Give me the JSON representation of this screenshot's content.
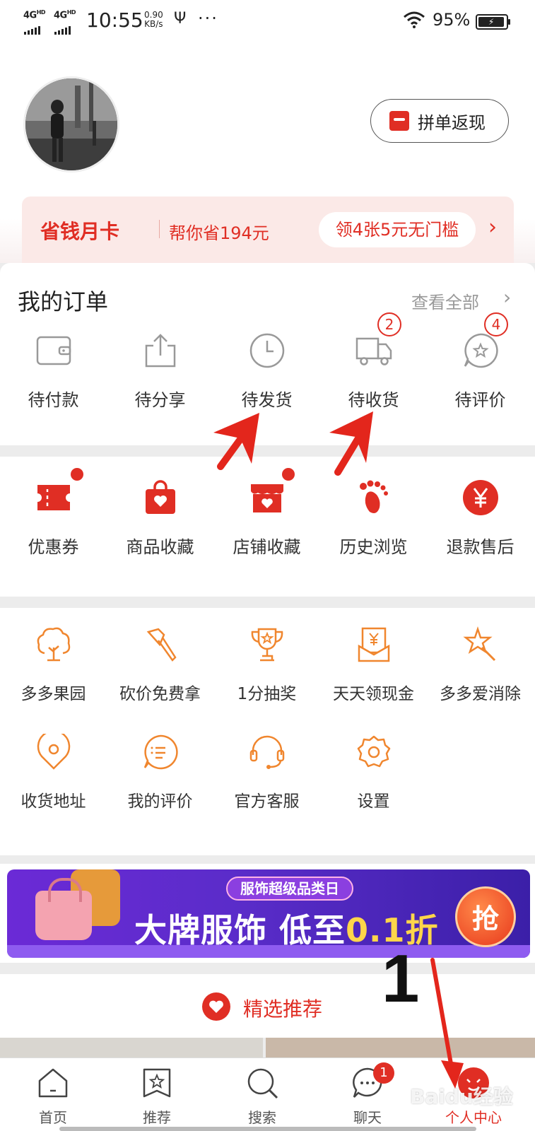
{
  "status_bar": {
    "net1": "4G",
    "net1_sup": "HD",
    "net2": "4G",
    "net2_sup": "HD",
    "time": "10:55",
    "speed_value": "0.90",
    "speed_unit": "KB/s",
    "more": "···",
    "battery_percent": "95%",
    "battery_level": 0.95
  },
  "header": {
    "group_button_label": "拼单返现"
  },
  "card_banner": {
    "title": "省钱月卡",
    "subtitle": "帮你省194元",
    "coupon_pill": "领4张5元无门槛"
  },
  "orders": {
    "title": "我的订单",
    "view_all": "查看全部",
    "items": [
      {
        "label": "待付款",
        "icon": "wallet-icon"
      },
      {
        "label": "待分享",
        "icon": "share-icon"
      },
      {
        "label": "待发货",
        "icon": "clock-icon"
      },
      {
        "label": "待收货",
        "icon": "truck-icon",
        "badge": "2"
      },
      {
        "label": "待评价",
        "icon": "review-star-icon",
        "badge": "4"
      }
    ]
  },
  "services": {
    "items": [
      {
        "label": "优惠券",
        "icon": "coupon-icon",
        "dot": true
      },
      {
        "label": "商品收藏",
        "icon": "bag-heart-icon"
      },
      {
        "label": "店铺收藏",
        "icon": "store-heart-icon",
        "dot": true
      },
      {
        "label": "历史浏览",
        "icon": "footprint-icon"
      },
      {
        "label": "退款售后",
        "icon": "yen-circle-icon"
      }
    ]
  },
  "tools": {
    "items": [
      {
        "label": "多多果园",
        "icon": "tree-icon"
      },
      {
        "label": "砍价免费拿",
        "icon": "axe-icon"
      },
      {
        "label": "1分抽奖",
        "icon": "trophy-icon"
      },
      {
        "label": "天天领现金",
        "icon": "cash-envelope-icon"
      },
      {
        "label": "多多爱消除",
        "icon": "star-wand-icon"
      },
      {
        "label": "收货地址",
        "icon": "location-icon"
      },
      {
        "label": "我的评价",
        "icon": "comment-list-icon"
      },
      {
        "label": "官方客服",
        "icon": "headset-icon"
      },
      {
        "label": "设置",
        "icon": "gear-icon"
      }
    ]
  },
  "promo": {
    "tag": "服饰超级品类日",
    "headline_a": "大牌服饰 低至",
    "headline_b": "0.1折",
    "grab": "抢"
  },
  "recommend": {
    "title": "精选推荐"
  },
  "tabbar": {
    "tabs": [
      {
        "label": "首页",
        "icon": "home-icon"
      },
      {
        "label": "推荐",
        "icon": "recommend-star-icon"
      },
      {
        "label": "搜索",
        "icon": "search-icon"
      },
      {
        "label": "聊天",
        "icon": "chat-icon",
        "badge": "1"
      },
      {
        "label": "个人中心",
        "icon": "profile-icon",
        "active": true
      }
    ]
  },
  "annotation": {
    "step_number": "1",
    "watermark": "Baidu经验"
  },
  "colors": {
    "brand_red": "#e02e24",
    "tool_orange": "#f0862e"
  }
}
